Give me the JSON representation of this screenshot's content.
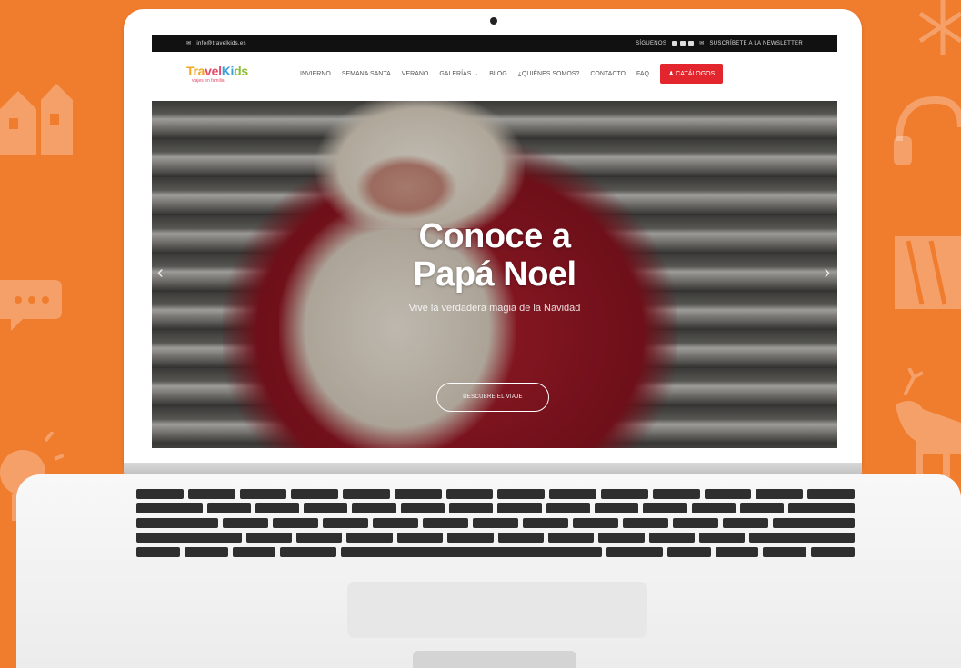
{
  "site": {
    "topbar": {
      "email": "info@travelkids.es",
      "follow": "SÍGUENOS",
      "newsletter": "SUSCRÍBETE A LA NEWSLETTER"
    },
    "logo": {
      "main": "TravelKids",
      "sub": "viajes en familia"
    },
    "nav": {
      "items": [
        "INVIERNO",
        "SEMANA SANTA",
        "VERANO",
        "GALERÍAS",
        "BLOG",
        "¿QUIÉNES SOMOS?",
        "CONTACTO",
        "FAQ"
      ],
      "cta": "CATÁLOGOS"
    },
    "hero": {
      "title_line1": "Conoce a",
      "title_line2": "Papá Noel",
      "subtitle": "Vive la verdadera magia de la Navidad",
      "button": "DESCUBRE EL VIAJE"
    }
  },
  "colors": {
    "background": "#f07c2e",
    "cta": "#e3262d"
  },
  "icons": [
    "house-icon",
    "chat-icon",
    "bulb-icon",
    "headset-icon",
    "snowflake-icon",
    "gift-icon",
    "reindeer-icon",
    "chevron-left-icon",
    "chevron-right-icon",
    "mail-icon",
    "user-icon"
  ]
}
